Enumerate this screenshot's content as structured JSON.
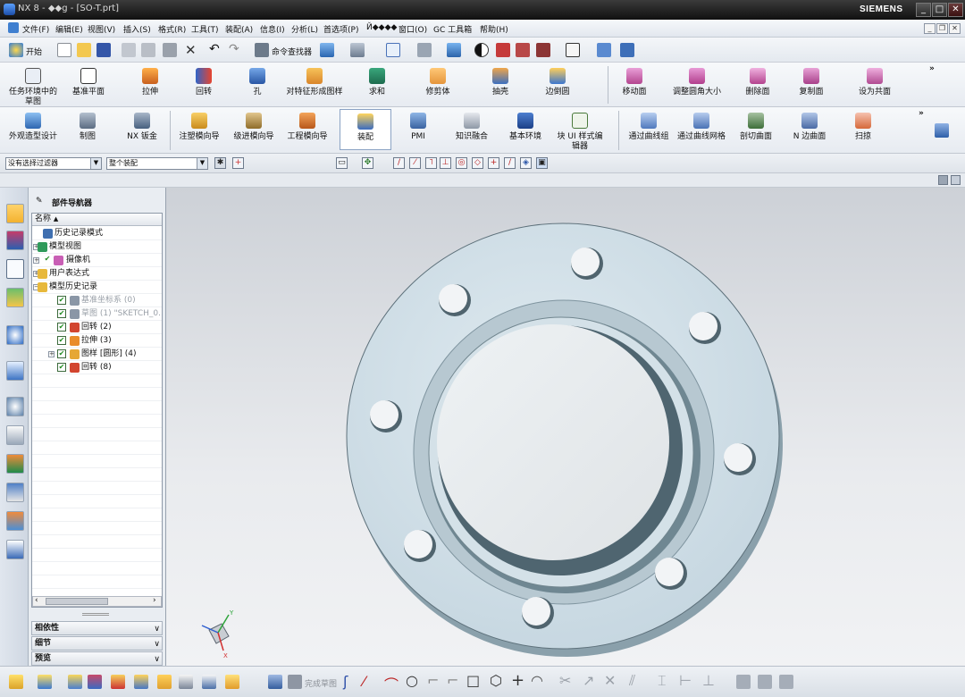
{
  "window": {
    "title": "NX 8 - ◆◆g - [SO-T.prt]",
    "brand": "SIEMENS",
    "min": "_",
    "max": "□",
    "close": "✕"
  },
  "menu": [
    "文件(F)",
    "编辑(E)",
    "视图(V)",
    "插入(S)",
    "格式(R)",
    "工具(T)",
    "装配(A)",
    "信息(I)",
    "分析(L)",
    "首选项(P)",
    "Й◆◆◆◆",
    "窗口(O)",
    "GC 工具箱",
    "帮助(H)"
  ],
  "standard_toolbar": {
    "start_label": "开始",
    "command_finder_label": "命令查找器"
  },
  "ribbon_row1": [
    "任务环境中的草图",
    "基准平面",
    "拉伸",
    "回转",
    "孔",
    "对特征形成图样",
    "求和",
    "修剪体",
    "抽壳",
    "边倒圆",
    "移动面",
    "调整圆角大小",
    "删除面",
    "复制面",
    "设为共面"
  ],
  "ribbon_row2": [
    "外观造型设计",
    "制图",
    "NX 钣金",
    "注塑模向导",
    "级进模向导",
    "工程模向导",
    "装配",
    "PMI",
    "知识融合",
    "基本环境",
    "块 UI 样式编辑器",
    "通过曲线组",
    "通过曲线网格",
    "剖切曲面",
    "N 边曲面",
    "扫掠"
  ],
  "filterbar": {
    "filter": "没有选择过滤器",
    "scope": "整个装配"
  },
  "navigator": {
    "title": "部件导航器",
    "column": "名称",
    "items": [
      {
        "label": "历史记录模式",
        "state": "normal"
      },
      {
        "label": "模型视图",
        "state": "normal"
      },
      {
        "label": "摄像机",
        "state": "normal"
      },
      {
        "label": "用户表达式",
        "state": "normal"
      },
      {
        "label": "模型历史记录",
        "state": "normal"
      },
      {
        "label": "基准坐标系 (0)",
        "state": "dim"
      },
      {
        "label": "草图 (1) \"SKETCH_0...",
        "state": "dim"
      },
      {
        "label": "回转 (2)",
        "state": "normal"
      },
      {
        "label": "拉伸 (3)",
        "state": "normal"
      },
      {
        "label": "图样 [圆形] (4)",
        "state": "normal"
      },
      {
        "label": "回转 (8)",
        "state": "normal"
      }
    ],
    "sections": [
      "相依性",
      "细节",
      "预览"
    ]
  },
  "bottom_toolbar": {
    "finish_sketch_label": "完成草图"
  },
  "colors": {
    "flange_face": "#cfdde6",
    "flange_edge": "#6e8590",
    "viewport_top": "#cdd1d7",
    "titlebar": "#1d1d1d"
  }
}
